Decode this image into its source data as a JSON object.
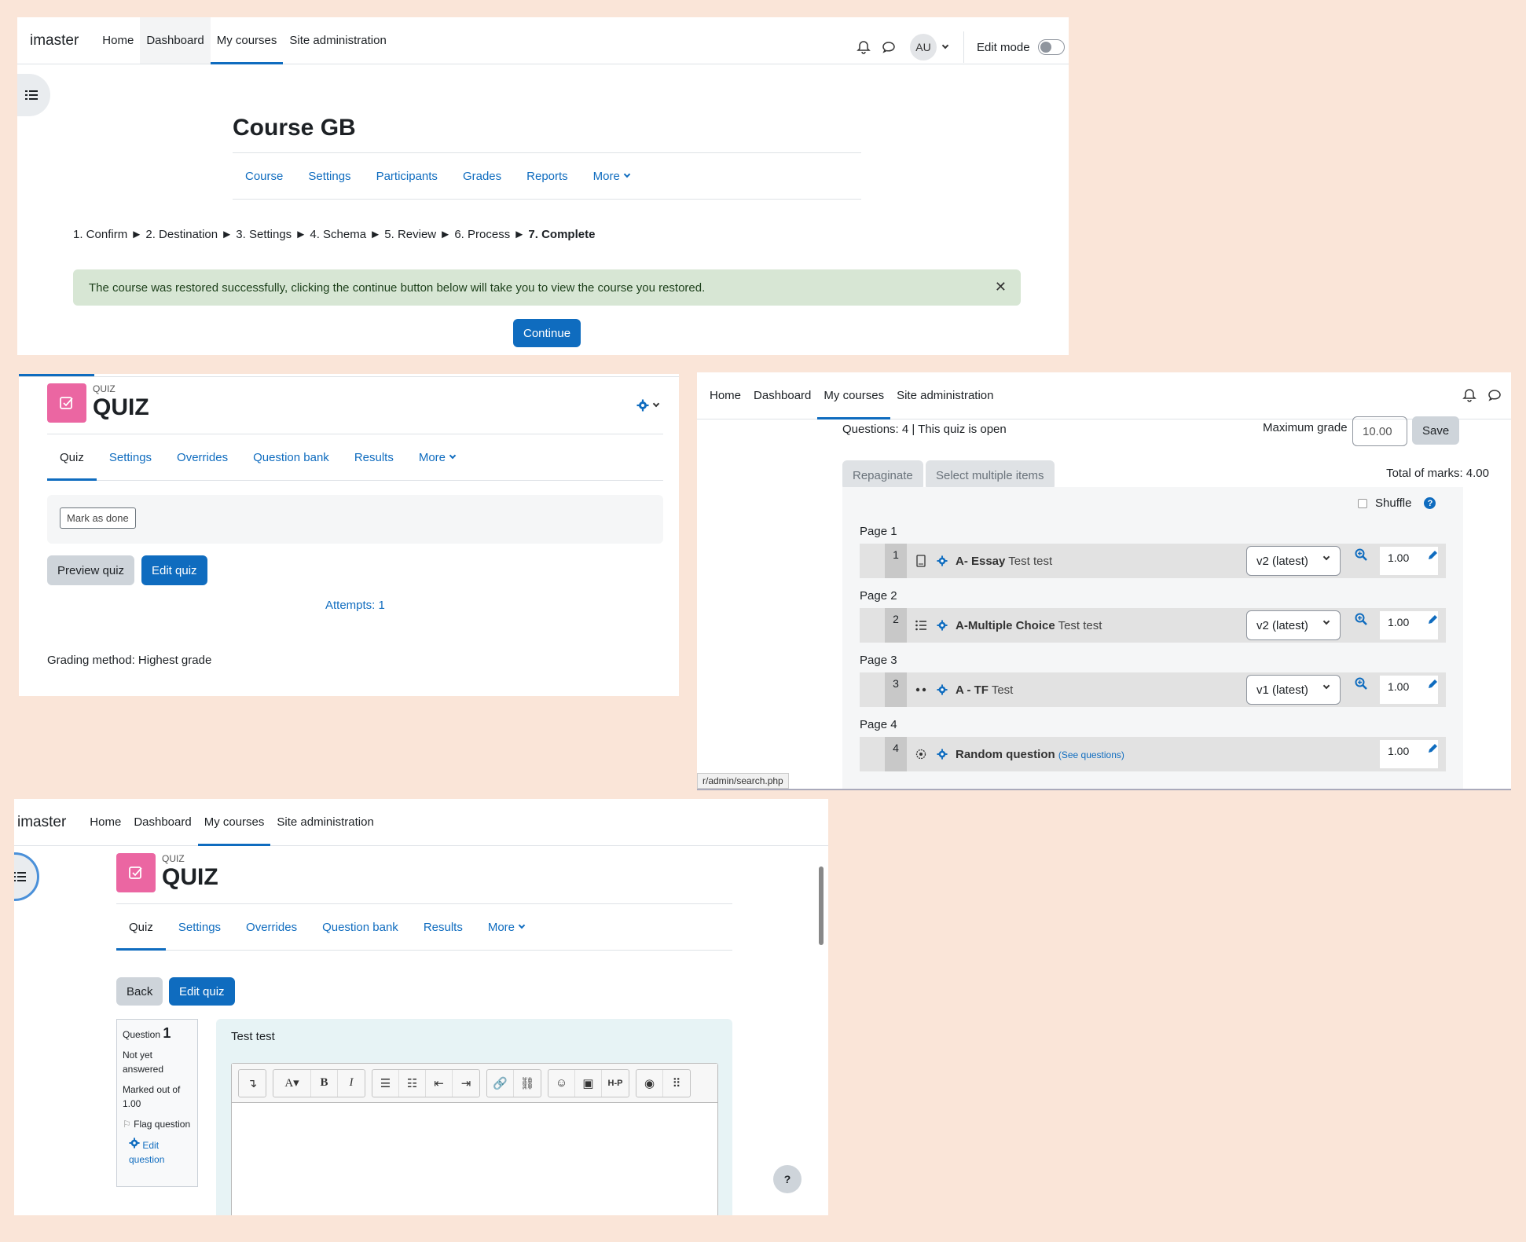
{
  "panel1": {
    "brand": "imaster",
    "nav": [
      "Home",
      "Dashboard",
      "My courses",
      "Site administration"
    ],
    "avatar": "AU",
    "edit_mode": "Edit mode",
    "course_title": "Course GB",
    "tabs": [
      "Course",
      "Settings",
      "Participants",
      "Grades",
      "Reports",
      "More"
    ],
    "steps": [
      "1. Confirm",
      "2. Destination",
      "3. Settings",
      "4. Schema",
      "5. Review",
      "6. Process"
    ],
    "step_current": "7. Complete",
    "alert": "The course was restored successfully, clicking the continue button below will take you to view the course you restored.",
    "continue": "Continue"
  },
  "panel2": {
    "label": "QUIZ",
    "title": "QUIZ",
    "tabs": [
      "Quiz",
      "Settings",
      "Overrides",
      "Question bank",
      "Results",
      "More"
    ],
    "mark_done": "Mark as done",
    "preview": "Preview quiz",
    "edit": "Edit quiz",
    "attempts": "Attempts: 1",
    "grading": "Grading method: Highest grade"
  },
  "panel3": {
    "nav": [
      "Home",
      "Dashboard",
      "My courses",
      "Site administration"
    ],
    "info": "Questions: 4 | This quiz is open",
    "max_grade_label": "Maximum grade",
    "max_grade": "10.00",
    "save": "Save",
    "repaginate": "Repaginate",
    "select_multiple": "Select multiple items",
    "total": "Total of marks: 4.00",
    "shuffle": "Shuffle",
    "questions": [
      {
        "page": "Page 1",
        "num": "1",
        "name": "A- Essay",
        "text": "Test test",
        "version": "v2 (latest)",
        "mark": "1.00"
      },
      {
        "page": "Page 2",
        "num": "2",
        "name": "A-Multiple Choice",
        "text": "Test test",
        "version": "v2 (latest)",
        "mark": "1.00"
      },
      {
        "page": "Page 3",
        "num": "3",
        "name": "A - TF",
        "text": "Test",
        "version": "v1 (latest)",
        "mark": "1.00"
      },
      {
        "page": "Page 4",
        "num": "4",
        "name": "Random question",
        "text": "(See questions)",
        "mark": "1.00"
      }
    ],
    "status_url": "r/admin/search.php"
  },
  "panel4": {
    "brand": "imaster",
    "nav": [
      "Home",
      "Dashboard",
      "My courses",
      "Site administration"
    ],
    "label": "QUIZ",
    "title": "QUIZ",
    "tabs": [
      "Quiz",
      "Settings",
      "Overrides",
      "Question bank",
      "Results",
      "More"
    ],
    "back": "Back",
    "edit": "Edit quiz",
    "q_label": "Question",
    "q_num": "1",
    "status": "Not yet answered",
    "marked": "Marked out of 1.00",
    "flag": "Flag question",
    "edit_question": "Edit question",
    "question_text": "Test test",
    "help": "?"
  }
}
